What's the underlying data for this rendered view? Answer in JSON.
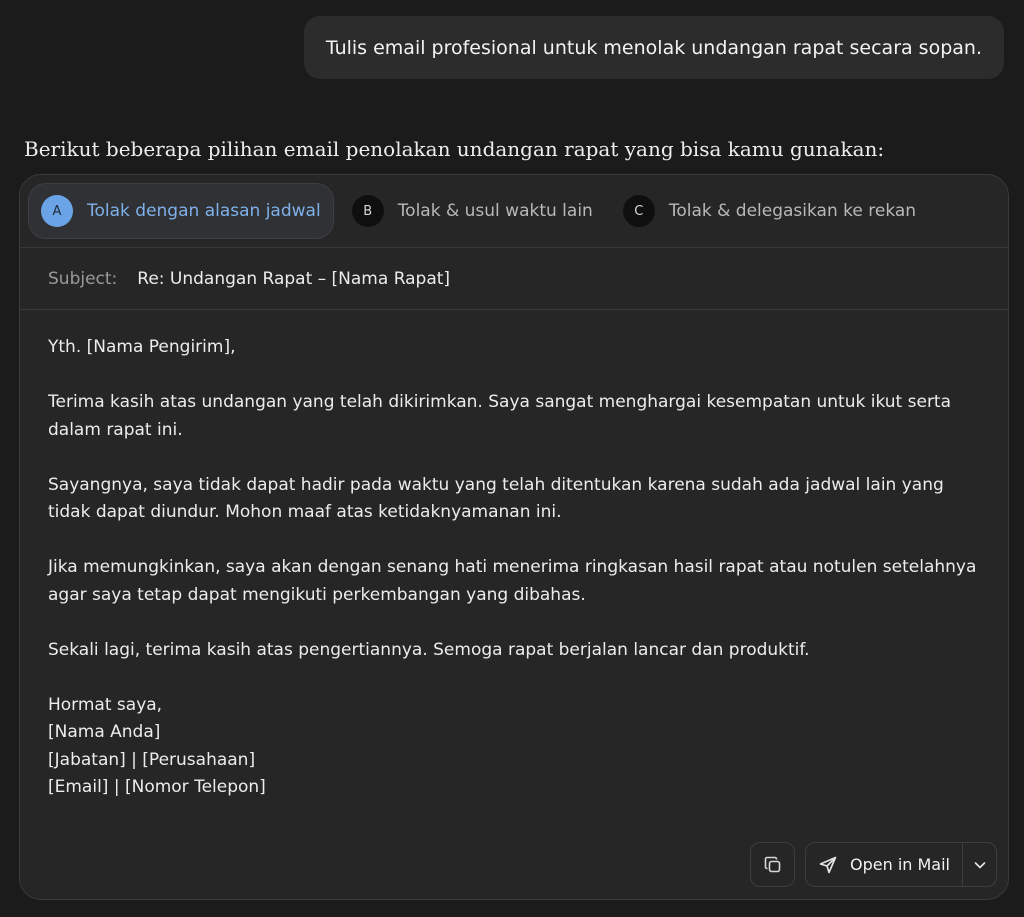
{
  "user_message": "Tulis email profesional untuk menolak undangan rapat secara sopan.",
  "assistant_intro": "Berikut beberapa pilihan email penolakan undangan rapat yang bisa kamu gunakan:",
  "tabs": [
    {
      "badge": "A",
      "label": "Tolak dengan alasan jadwal",
      "active": true
    },
    {
      "badge": "B",
      "label": "Tolak & usul waktu lain",
      "active": false
    },
    {
      "badge": "C",
      "label": "Tolak & delegasikan ke rekan",
      "active": false
    }
  ],
  "email": {
    "subject_label": "Subject:",
    "subject_value": "Re: Undangan Rapat – [Nama Rapat]",
    "greeting": "Yth. [Nama Pengirim],",
    "paragraphs": [
      "Terima kasih atas undangan yang telah dikirimkan. Saya sangat menghargai kesempatan untuk ikut serta dalam rapat ini.",
      "Sayangnya, saya tidak dapat hadir pada waktu yang telah ditentukan karena sudah ada jadwal lain yang tidak dapat diundur. Mohon maaf atas ketidaknyamanan ini.",
      "Jika memungkinkan, saya akan dengan senang hati menerima ringkasan hasil rapat atau notulen setelahnya agar saya tetap dapat mengikuti perkembangan yang dibahas.",
      "Sekali lagi, terima kasih atas pengertiannya. Semoga rapat berjalan lancar dan produktif."
    ],
    "closing": "Hormat saya,",
    "signature": [
      "[Nama Anda]",
      "[Jabatan] | [Perusahaan]",
      "[Email] | [Nomor Telepon]"
    ]
  },
  "actions": {
    "copy_icon": "copy-icon",
    "open_mail_label": "Open in Mail",
    "send_icon": "send-icon",
    "dropdown_icon": "chevron-down-icon"
  },
  "colors": {
    "background": "#1b1b1b",
    "card": "#262626",
    "accent": "#6aa3e6",
    "active_tab_text": "#7fb0ea"
  }
}
